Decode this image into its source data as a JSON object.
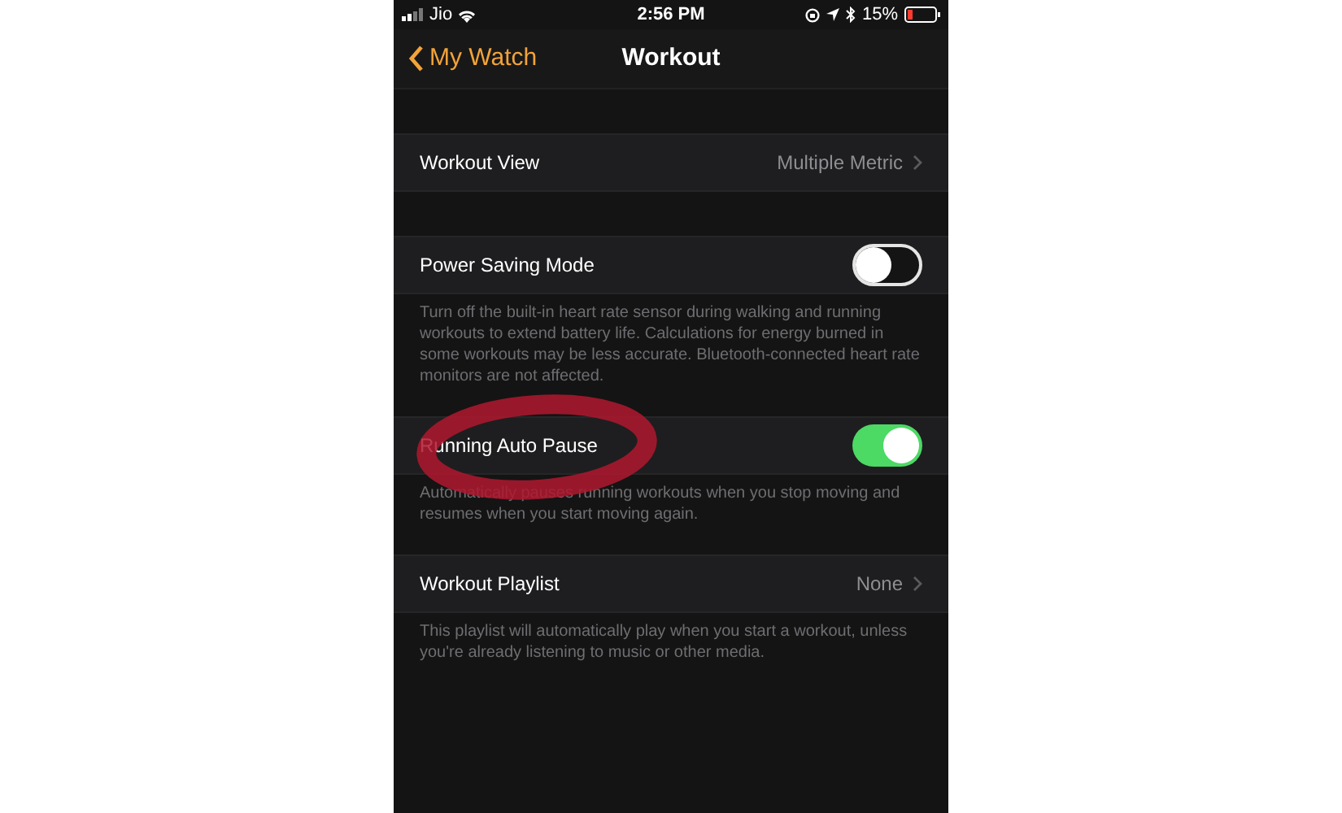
{
  "status_bar": {
    "carrier": "Jio",
    "time": "2:56 PM",
    "battery": "15%"
  },
  "nav": {
    "back": "My Watch",
    "title": "Workout"
  },
  "sections": [
    {
      "kind": "link",
      "label": "Workout View",
      "value": "Multiple Metric"
    },
    {
      "kind": "toggle",
      "label": "Power Saving Mode",
      "on": false,
      "footer": "Turn off the built-in heart rate sensor during walking and running workouts to extend battery life. Calculations for energy burned in some workouts may be less accurate. Bluetooth-connected heart rate monitors are not affected."
    },
    {
      "kind": "toggle",
      "label": "Running Auto Pause",
      "on": true,
      "circled": true,
      "footer": "Automatically pauses running workouts when you stop moving and resumes when you start moving again."
    },
    {
      "kind": "link",
      "label": "Workout Playlist",
      "value": "None",
      "footer": "This playlist will automatically play when you start a workout, unless you're already listening to music or other media."
    }
  ]
}
